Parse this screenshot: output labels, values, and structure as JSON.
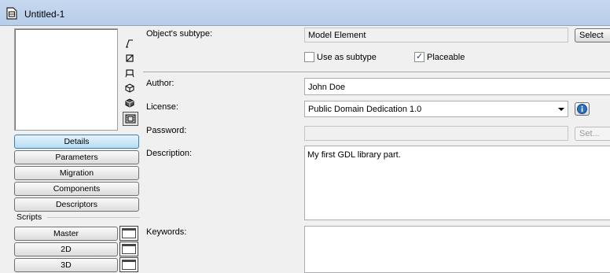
{
  "window": {
    "title": "Untitled-1"
  },
  "left_panel": {
    "view_icons": [
      "line-view-icon",
      "rect-view-icon",
      "table-view-icon",
      "cube-view-icon",
      "solid-cube-view-icon",
      "film-view-icon"
    ],
    "sections": [
      {
        "label": "Details",
        "selected": true
      },
      {
        "label": "Parameters"
      },
      {
        "label": "Migration"
      },
      {
        "label": "Components"
      },
      {
        "label": "Descriptors"
      }
    ],
    "scripts_label": "Scripts",
    "scripts": [
      {
        "label": "Master"
      },
      {
        "label": "2D"
      },
      {
        "label": "3D"
      }
    ]
  },
  "form": {
    "subtype_label": "Object's subtype:",
    "subtype_value": "Model Element",
    "select_subtype_button": "Select Subtype...",
    "use_as_subtype_label": "Use as subtype",
    "use_as_subtype_checked": false,
    "placeable_label": "Placeable",
    "placeable_checked": true,
    "author_label": "Author:",
    "author_value": "John Doe",
    "license_label": "License:",
    "license_value": "Public Domain Dedication 1.0",
    "password_label": "Password:",
    "password_value": "",
    "set_password_button": "Set...",
    "description_label": "Description:",
    "description_value": "My first GDL library part.",
    "keywords_label": "Keywords:",
    "keywords_value": ""
  }
}
